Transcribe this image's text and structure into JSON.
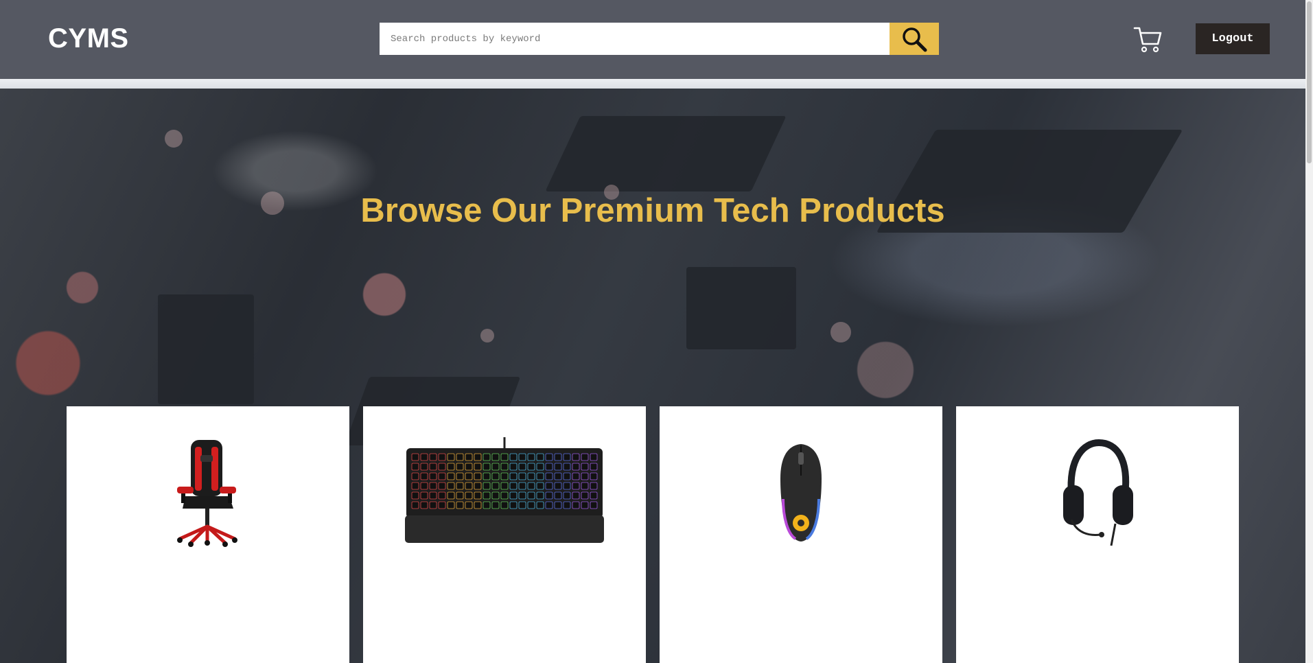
{
  "header": {
    "logo": "CYMS",
    "search": {
      "placeholder": "Search products by keyword",
      "value": ""
    },
    "logout_label": "Logout",
    "colors": {
      "bar": "#555862",
      "accent": "#e8bd4c",
      "logout_bg": "#2a2523"
    },
    "icons": {
      "search": "magnifier-icon",
      "cart": "shopping-cart-icon"
    }
  },
  "hero": {
    "title": "Browse Our Premium Tech Products",
    "title_color": "#e8bd4c"
  },
  "products": [
    {
      "image": "gaming-chair"
    },
    {
      "image": "rgb-keyboard"
    },
    {
      "image": "gaming-mouse"
    },
    {
      "image": "headset"
    }
  ]
}
